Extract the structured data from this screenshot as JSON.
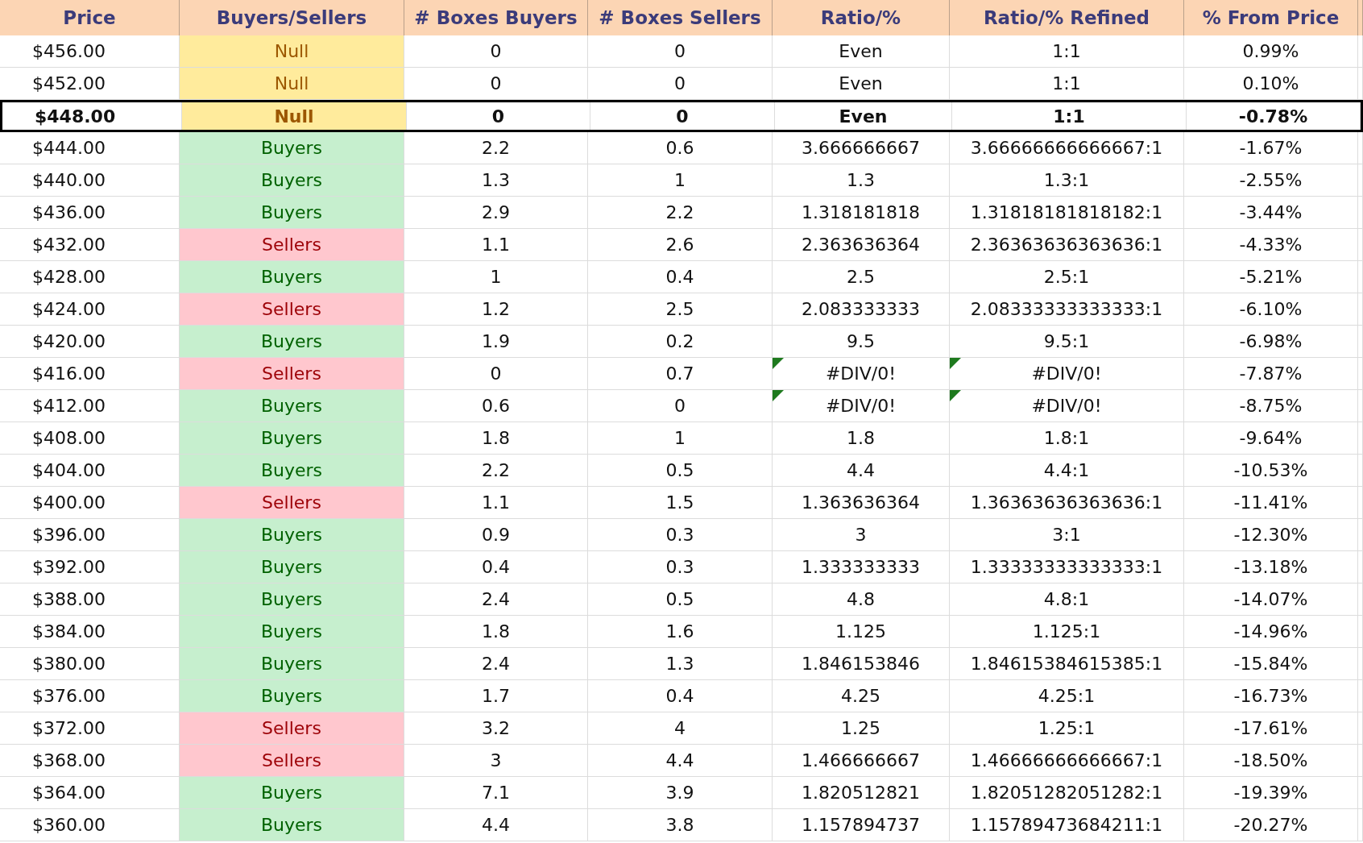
{
  "columns": [
    "Price",
    "Buyers/Sellers",
    "# Boxes Buyers",
    "# Boxes Sellers",
    "Ratio/%",
    "Ratio/% Refined",
    "% From Price"
  ],
  "rows": [
    {
      "price": "$456.00",
      "side": "Null",
      "kind": "null",
      "buyers": "0",
      "sellers": "0",
      "ratio": "Even",
      "refined": "1:1",
      "pct": "0.99%",
      "highlighted": false,
      "error_flag": false
    },
    {
      "price": "$452.00",
      "side": "Null",
      "kind": "null",
      "buyers": "0",
      "sellers": "0",
      "ratio": "Even",
      "refined": "1:1",
      "pct": "0.10%",
      "highlighted": false,
      "error_flag": false
    },
    {
      "price": "$448.00",
      "side": "Null",
      "kind": "null",
      "buyers": "0",
      "sellers": "0",
      "ratio": "Even",
      "refined": "1:1",
      "pct": "-0.78%",
      "highlighted": true,
      "error_flag": false
    },
    {
      "price": "$444.00",
      "side": "Buyers",
      "kind": "buyers",
      "buyers": "2.2",
      "sellers": "0.6",
      "ratio": "3.666666667",
      "refined": "3.66666666666667:1",
      "pct": "-1.67%",
      "highlighted": false,
      "error_flag": false
    },
    {
      "price": "$440.00",
      "side": "Buyers",
      "kind": "buyers",
      "buyers": "1.3",
      "sellers": "1",
      "ratio": "1.3",
      "refined": "1.3:1",
      "pct": "-2.55%",
      "highlighted": false,
      "error_flag": false
    },
    {
      "price": "$436.00",
      "side": "Buyers",
      "kind": "buyers",
      "buyers": "2.9",
      "sellers": "2.2",
      "ratio": "1.318181818",
      "refined": "1.31818181818182:1",
      "pct": "-3.44%",
      "highlighted": false,
      "error_flag": false
    },
    {
      "price": "$432.00",
      "side": "Sellers",
      "kind": "sellers",
      "buyers": "1.1",
      "sellers": "2.6",
      "ratio": "2.363636364",
      "refined": "2.36363636363636:1",
      "pct": "-4.33%",
      "highlighted": false,
      "error_flag": false
    },
    {
      "price": "$428.00",
      "side": "Buyers",
      "kind": "buyers",
      "buyers": "1",
      "sellers": "0.4",
      "ratio": "2.5",
      "refined": "2.5:1",
      "pct": "-5.21%",
      "highlighted": false,
      "error_flag": false
    },
    {
      "price": "$424.00",
      "side": "Sellers",
      "kind": "sellers",
      "buyers": "1.2",
      "sellers": "2.5",
      "ratio": "2.083333333",
      "refined": "2.08333333333333:1",
      "pct": "-6.10%",
      "highlighted": false,
      "error_flag": false
    },
    {
      "price": "$420.00",
      "side": "Buyers",
      "kind": "buyers",
      "buyers": "1.9",
      "sellers": "0.2",
      "ratio": "9.5",
      "refined": "9.5:1",
      "pct": "-6.98%",
      "highlighted": false,
      "error_flag": false
    },
    {
      "price": "$416.00",
      "side": "Sellers",
      "kind": "sellers",
      "buyers": "0",
      "sellers": "0.7",
      "ratio": "#DIV/0!",
      "refined": "#DIV/0!",
      "pct": "-7.87%",
      "highlighted": false,
      "error_flag": true
    },
    {
      "price": "$412.00",
      "side": "Buyers",
      "kind": "buyers",
      "buyers": "0.6",
      "sellers": "0",
      "ratio": "#DIV/0!",
      "refined": "#DIV/0!",
      "pct": "-8.75%",
      "highlighted": false,
      "error_flag": true
    },
    {
      "price": "$408.00",
      "side": "Buyers",
      "kind": "buyers",
      "buyers": "1.8",
      "sellers": "1",
      "ratio": "1.8",
      "refined": "1.8:1",
      "pct": "-9.64%",
      "highlighted": false,
      "error_flag": false
    },
    {
      "price": "$404.00",
      "side": "Buyers",
      "kind": "buyers",
      "buyers": "2.2",
      "sellers": "0.5",
      "ratio": "4.4",
      "refined": "4.4:1",
      "pct": "-10.53%",
      "highlighted": false,
      "error_flag": false
    },
    {
      "price": "$400.00",
      "side": "Sellers",
      "kind": "sellers",
      "buyers": "1.1",
      "sellers": "1.5",
      "ratio": "1.363636364",
      "refined": "1.36363636363636:1",
      "pct": "-11.41%",
      "highlighted": false,
      "error_flag": false
    },
    {
      "price": "$396.00",
      "side": "Buyers",
      "kind": "buyers",
      "buyers": "0.9",
      "sellers": "0.3",
      "ratio": "3",
      "refined": "3:1",
      "pct": "-12.30%",
      "highlighted": false,
      "error_flag": false
    },
    {
      "price": "$392.00",
      "side": "Buyers",
      "kind": "buyers",
      "buyers": "0.4",
      "sellers": "0.3",
      "ratio": "1.333333333",
      "refined": "1.33333333333333:1",
      "pct": "-13.18%",
      "highlighted": false,
      "error_flag": false
    },
    {
      "price": "$388.00",
      "side": "Buyers",
      "kind": "buyers",
      "buyers": "2.4",
      "sellers": "0.5",
      "ratio": "4.8",
      "refined": "4.8:1",
      "pct": "-14.07%",
      "highlighted": false,
      "error_flag": false
    },
    {
      "price": "$384.00",
      "side": "Buyers",
      "kind": "buyers",
      "buyers": "1.8",
      "sellers": "1.6",
      "ratio": "1.125",
      "refined": "1.125:1",
      "pct": "-14.96%",
      "highlighted": false,
      "error_flag": false
    },
    {
      "price": "$380.00",
      "side": "Buyers",
      "kind": "buyers",
      "buyers": "2.4",
      "sellers": "1.3",
      "ratio": "1.846153846",
      "refined": "1.84615384615385:1",
      "pct": "-15.84%",
      "highlighted": false,
      "error_flag": false
    },
    {
      "price": "$376.00",
      "side": "Buyers",
      "kind": "buyers",
      "buyers": "1.7",
      "sellers": "0.4",
      "ratio": "4.25",
      "refined": "4.25:1",
      "pct": "-16.73%",
      "highlighted": false,
      "error_flag": false
    },
    {
      "price": "$372.00",
      "side": "Sellers",
      "kind": "sellers",
      "buyers": "3.2",
      "sellers": "4",
      "ratio": "1.25",
      "refined": "1.25:1",
      "pct": "-17.61%",
      "highlighted": false,
      "error_flag": false
    },
    {
      "price": "$368.00",
      "side": "Sellers",
      "kind": "sellers",
      "buyers": "3",
      "sellers": "4.4",
      "ratio": "1.466666667",
      "refined": "1.46666666666667:1",
      "pct": "-18.50%",
      "highlighted": false,
      "error_flag": false
    },
    {
      "price": "$364.00",
      "side": "Buyers",
      "kind": "buyers",
      "buyers": "7.1",
      "sellers": "3.9",
      "ratio": "1.820512821",
      "refined": "1.82051282051282:1",
      "pct": "-19.39%",
      "highlighted": false,
      "error_flag": false
    },
    {
      "price": "$360.00",
      "side": "Buyers",
      "kind": "buyers",
      "buyers": "4.4",
      "sellers": "3.8",
      "ratio": "1.157894737",
      "refined": "1.15789473684211:1",
      "pct": "-20.27%",
      "highlighted": false,
      "error_flag": false
    }
  ]
}
